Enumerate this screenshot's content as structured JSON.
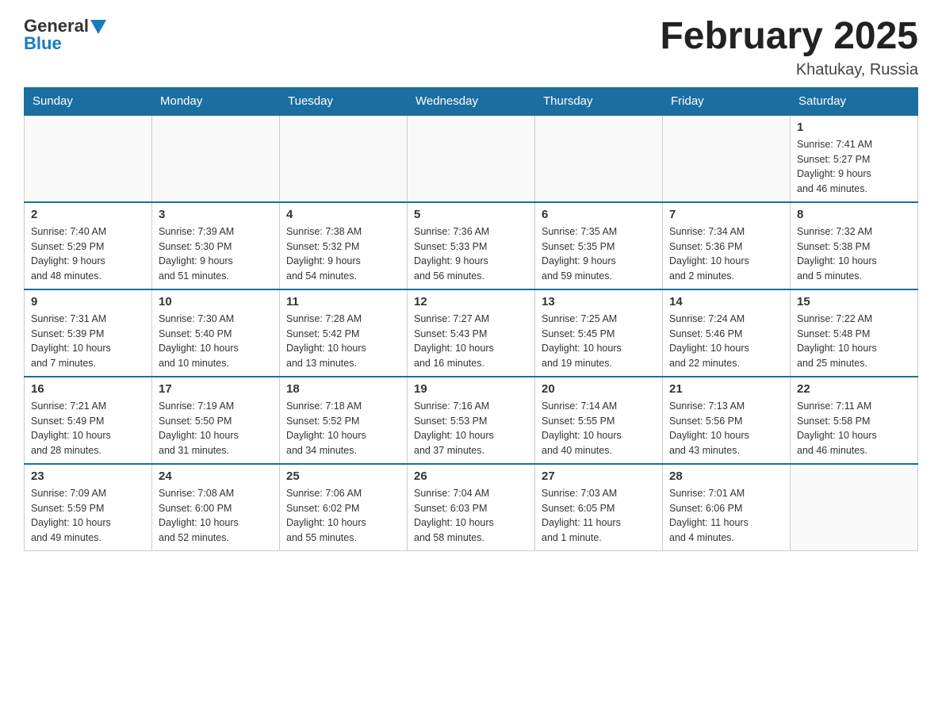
{
  "header": {
    "logo_general": "General",
    "logo_blue": "Blue",
    "month_title": "February 2025",
    "location": "Khatukay, Russia"
  },
  "days_of_week": [
    "Sunday",
    "Monday",
    "Tuesday",
    "Wednesday",
    "Thursday",
    "Friday",
    "Saturday"
  ],
  "weeks": [
    [
      {
        "day": "",
        "info": ""
      },
      {
        "day": "",
        "info": ""
      },
      {
        "day": "",
        "info": ""
      },
      {
        "day": "",
        "info": ""
      },
      {
        "day": "",
        "info": ""
      },
      {
        "day": "",
        "info": ""
      },
      {
        "day": "1",
        "info": "Sunrise: 7:41 AM\nSunset: 5:27 PM\nDaylight: 9 hours\nand 46 minutes."
      }
    ],
    [
      {
        "day": "2",
        "info": "Sunrise: 7:40 AM\nSunset: 5:29 PM\nDaylight: 9 hours\nand 48 minutes."
      },
      {
        "day": "3",
        "info": "Sunrise: 7:39 AM\nSunset: 5:30 PM\nDaylight: 9 hours\nand 51 minutes."
      },
      {
        "day": "4",
        "info": "Sunrise: 7:38 AM\nSunset: 5:32 PM\nDaylight: 9 hours\nand 54 minutes."
      },
      {
        "day": "5",
        "info": "Sunrise: 7:36 AM\nSunset: 5:33 PM\nDaylight: 9 hours\nand 56 minutes."
      },
      {
        "day": "6",
        "info": "Sunrise: 7:35 AM\nSunset: 5:35 PM\nDaylight: 9 hours\nand 59 minutes."
      },
      {
        "day": "7",
        "info": "Sunrise: 7:34 AM\nSunset: 5:36 PM\nDaylight: 10 hours\nand 2 minutes."
      },
      {
        "day": "8",
        "info": "Sunrise: 7:32 AM\nSunset: 5:38 PM\nDaylight: 10 hours\nand 5 minutes."
      }
    ],
    [
      {
        "day": "9",
        "info": "Sunrise: 7:31 AM\nSunset: 5:39 PM\nDaylight: 10 hours\nand 7 minutes."
      },
      {
        "day": "10",
        "info": "Sunrise: 7:30 AM\nSunset: 5:40 PM\nDaylight: 10 hours\nand 10 minutes."
      },
      {
        "day": "11",
        "info": "Sunrise: 7:28 AM\nSunset: 5:42 PM\nDaylight: 10 hours\nand 13 minutes."
      },
      {
        "day": "12",
        "info": "Sunrise: 7:27 AM\nSunset: 5:43 PM\nDaylight: 10 hours\nand 16 minutes."
      },
      {
        "day": "13",
        "info": "Sunrise: 7:25 AM\nSunset: 5:45 PM\nDaylight: 10 hours\nand 19 minutes."
      },
      {
        "day": "14",
        "info": "Sunrise: 7:24 AM\nSunset: 5:46 PM\nDaylight: 10 hours\nand 22 minutes."
      },
      {
        "day": "15",
        "info": "Sunrise: 7:22 AM\nSunset: 5:48 PM\nDaylight: 10 hours\nand 25 minutes."
      }
    ],
    [
      {
        "day": "16",
        "info": "Sunrise: 7:21 AM\nSunset: 5:49 PM\nDaylight: 10 hours\nand 28 minutes."
      },
      {
        "day": "17",
        "info": "Sunrise: 7:19 AM\nSunset: 5:50 PM\nDaylight: 10 hours\nand 31 minutes."
      },
      {
        "day": "18",
        "info": "Sunrise: 7:18 AM\nSunset: 5:52 PM\nDaylight: 10 hours\nand 34 minutes."
      },
      {
        "day": "19",
        "info": "Sunrise: 7:16 AM\nSunset: 5:53 PM\nDaylight: 10 hours\nand 37 minutes."
      },
      {
        "day": "20",
        "info": "Sunrise: 7:14 AM\nSunset: 5:55 PM\nDaylight: 10 hours\nand 40 minutes."
      },
      {
        "day": "21",
        "info": "Sunrise: 7:13 AM\nSunset: 5:56 PM\nDaylight: 10 hours\nand 43 minutes."
      },
      {
        "day": "22",
        "info": "Sunrise: 7:11 AM\nSunset: 5:58 PM\nDaylight: 10 hours\nand 46 minutes."
      }
    ],
    [
      {
        "day": "23",
        "info": "Sunrise: 7:09 AM\nSunset: 5:59 PM\nDaylight: 10 hours\nand 49 minutes."
      },
      {
        "day": "24",
        "info": "Sunrise: 7:08 AM\nSunset: 6:00 PM\nDaylight: 10 hours\nand 52 minutes."
      },
      {
        "day": "25",
        "info": "Sunrise: 7:06 AM\nSunset: 6:02 PM\nDaylight: 10 hours\nand 55 minutes."
      },
      {
        "day": "26",
        "info": "Sunrise: 7:04 AM\nSunset: 6:03 PM\nDaylight: 10 hours\nand 58 minutes."
      },
      {
        "day": "27",
        "info": "Sunrise: 7:03 AM\nSunset: 6:05 PM\nDaylight: 11 hours\nand 1 minute."
      },
      {
        "day": "28",
        "info": "Sunrise: 7:01 AM\nSunset: 6:06 PM\nDaylight: 11 hours\nand 4 minutes."
      },
      {
        "day": "",
        "info": ""
      }
    ]
  ]
}
